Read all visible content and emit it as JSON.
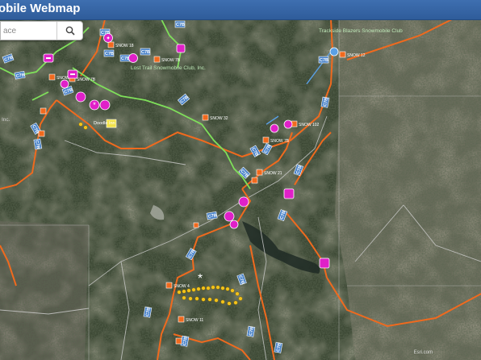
{
  "app": {
    "title": "obile Webmap"
  },
  "search": {
    "placeholder": "ace"
  },
  "icons": {
    "search_button": "magnifier-icon"
  },
  "colors": {
    "header": "#2f5c9a",
    "trail_orange": "#f06a1e",
    "trail_green": "#7fe05a",
    "trail_blue": "#5aa0e6",
    "poi_magenta": "#e020c8",
    "marker_yellow": "#f2c21a"
  },
  "map": {
    "club_labels": [
      "Trackside Blazers Snowmobile Club",
      "Lost Trail Snowmobile Club, Inc.",
      "Inc."
    ],
    "trail_tags": [
      "C7B",
      "C7B",
      "C7B",
      "C7B",
      "C7B",
      "C7B",
      "C7B",
      "C7B",
      "C7B",
      "C7B",
      "C7B",
      "C7B",
      "C7B",
      "C7B",
      "C7B",
      "C7B",
      "C7B",
      "C7B",
      "C7B",
      "C7B",
      "C7B",
      "C7B",
      "C7B",
      "C7B",
      "C7B"
    ],
    "junction_labels": [
      "SNOW 18",
      "SNOW 7B",
      "SNOW 14",
      "SNOW 7B",
      "SNOW 32",
      "SNOW 12",
      "SNOW 102",
      "SNOW 7B",
      "SNOW 21",
      "SNOW 4",
      "SNOW 11"
    ],
    "poi_labels": [
      "Doodle Inn"
    ],
    "attribution": "Esri.com"
  }
}
